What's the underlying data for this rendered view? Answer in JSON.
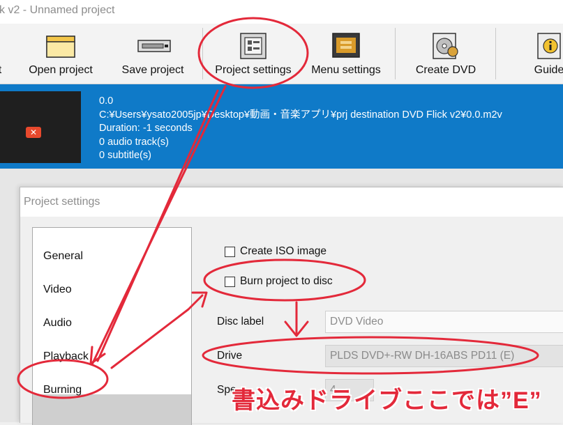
{
  "window": {
    "title": "k v2 - Unnamed project"
  },
  "toolbar": {
    "items": [
      {
        "label": "t",
        "icon": "partial-icon"
      },
      {
        "label": "Open project",
        "icon": "folder-icon"
      },
      {
        "label": "Save project",
        "icon": "save-drive-icon"
      },
      {
        "label": "Project settings",
        "icon": "settings-panel-icon"
      },
      {
        "label": "Menu settings",
        "icon": "menu-monitor-icon"
      },
      {
        "label": "Create DVD",
        "icon": "dvd-disc-icon"
      },
      {
        "label": "Guide",
        "icon": "guide-info-icon"
      }
    ]
  },
  "project_info": {
    "lines": [
      "0.0",
      "C:¥Users¥ysato2005jp¥Desktop¥動画・音楽アプリ¥prj destination DVD Flick v2¥0.0.m2v",
      "Duration: -1 seconds",
      "0 audio track(s)",
      "0 subtitle(s)"
    ],
    "thumbnail_icon": "error-x-icon"
  },
  "dialog": {
    "title": "Project settings",
    "nav_items": [
      "General",
      "Video",
      "Audio",
      "Playback",
      "Burning"
    ],
    "selected_nav": "Burning",
    "create_iso_label": "Create ISO image",
    "burn_label": "Burn project to disc",
    "disc_label_label": "Disc label",
    "disc_label_value": "DVD Video",
    "drive_label": "Drive",
    "drive_value": "PLDS DVD+-RW DH-16ABS PD11 (E)",
    "speed_label": "Spe",
    "speed_value": "4"
  },
  "annotation": {
    "text": "書込みドライブここでは”E”",
    "color": "#e3293a"
  },
  "colors": {
    "info_bar": "#0f7ac8",
    "annotation_red": "#e3293a"
  }
}
